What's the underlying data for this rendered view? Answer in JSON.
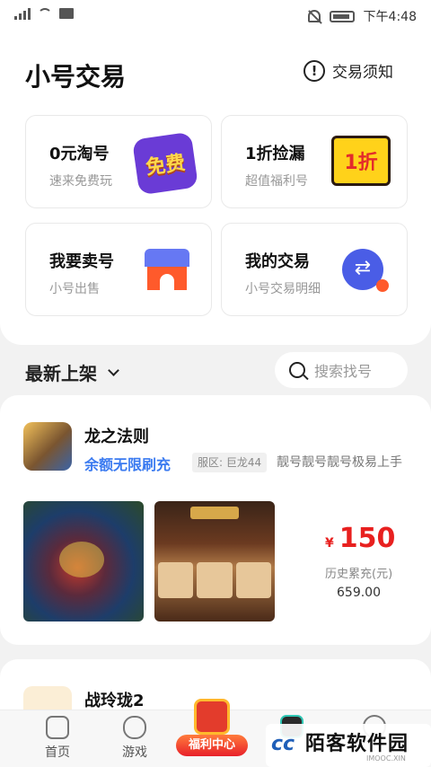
{
  "status_bar": {
    "time": "下午4:48"
  },
  "header": {
    "title": "小号交易",
    "notice_label": "交易须知",
    "notice_icon": "!"
  },
  "cards": [
    {
      "title": "0元淘号",
      "subtitle": "速来免费玩",
      "badge": "免费"
    },
    {
      "title": "1折捡漏",
      "subtitle": "超值福利号",
      "badge": "1折"
    },
    {
      "title": "我要卖号",
      "subtitle": "小号出售"
    },
    {
      "title": "我的交易",
      "subtitle": "小号交易明细"
    }
  ],
  "section": {
    "title": "最新上架",
    "search_placeholder": "搜索找号"
  },
  "listings": [
    {
      "game": "龙之法则",
      "promo": "余额无限刷充",
      "server": "服区: 巨龙44",
      "description": "靓号靓号靓号极易上手",
      "currency": "¥",
      "price": "150",
      "history_label": "历史累充(元)",
      "history_value": "659.00"
    },
    {
      "game": "战玲珑2"
    }
  ],
  "bottom_nav": {
    "home": "首页",
    "games": "游戏",
    "welfare": "福利中心"
  },
  "watermark": {
    "logo": "cc",
    "text": "陌客软件园",
    "sub": "IMOOC.XIN"
  },
  "colors": {
    "accent_blue": "#3a7af0",
    "price_red": "#e8201f",
    "swap_blue": "#4a5de6",
    "shop_orange": "#ff5a2b"
  }
}
